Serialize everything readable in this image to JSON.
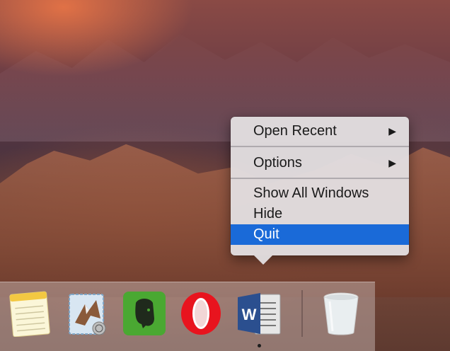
{
  "context_menu": {
    "items": [
      {
        "label": "Open Recent",
        "submenu": true
      },
      {
        "label": "Options",
        "submenu": true
      },
      {
        "label": "Show All Windows",
        "submenu": false
      },
      {
        "label": "Hide",
        "submenu": false
      },
      {
        "label": "Quit",
        "submenu": false,
        "selected": true
      }
    ],
    "submenu_arrow": "▶",
    "highlight_color": "#1a6ad8"
  },
  "dock": {
    "apps": [
      {
        "name": "notes-icon"
      },
      {
        "name": "mail-icon"
      },
      {
        "name": "evernote-icon"
      },
      {
        "name": "opera-icon"
      },
      {
        "name": "word-icon",
        "running": true
      },
      {
        "name": "trash-icon"
      }
    ],
    "word_letter": "W"
  }
}
